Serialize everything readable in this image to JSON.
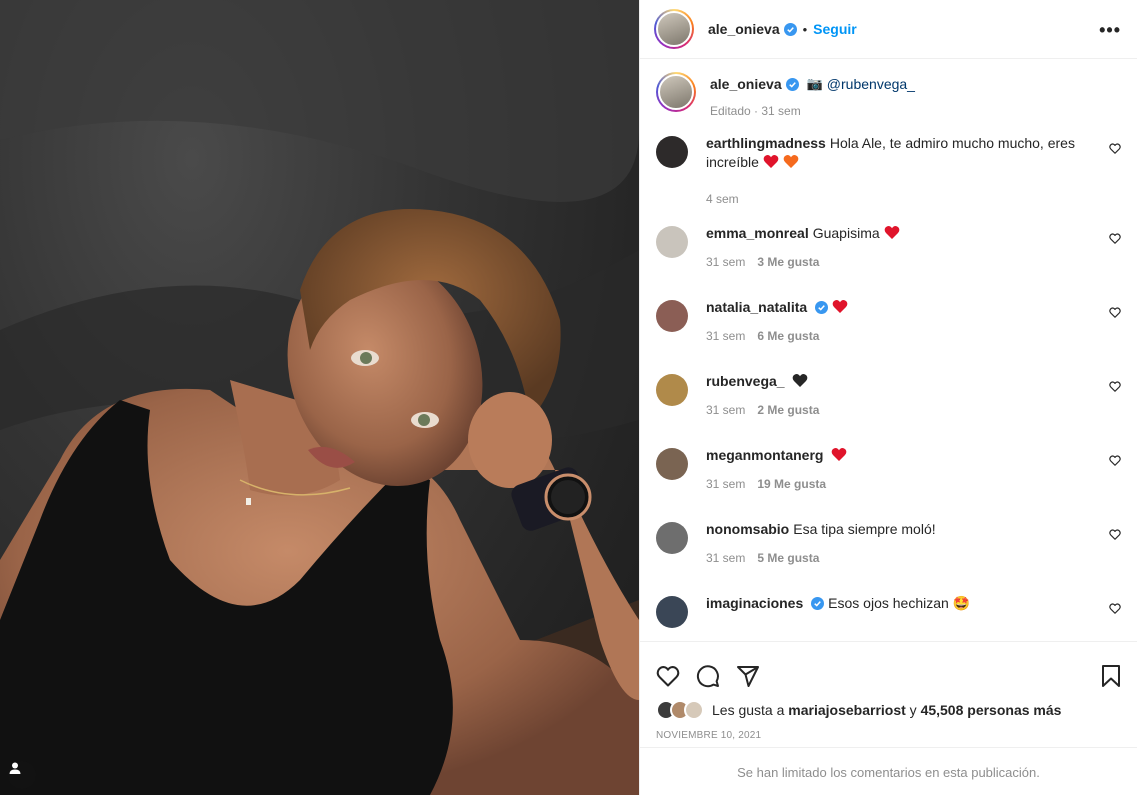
{
  "header": {
    "username": "ale_onieva",
    "separator": "•",
    "follow_label": "Seguir",
    "more_label": "•••"
  },
  "caption": {
    "username": "ale_onieva",
    "camera_emoji": "📷",
    "mention": "@rubenvega_",
    "meta": "Editado · 31 sem"
  },
  "comments": [
    {
      "username": "earthlingmadness",
      "text": "Hola Ale, te admiro mucho mucho, eres increíble",
      "hearts": [
        "#e0142b",
        "#f56a1e"
      ],
      "time": "4 sem",
      "likes": "",
      "avatar_color": "#2d2a2a",
      "verified": false
    },
    {
      "username": "emma_monreal",
      "text": "Guapisima",
      "hearts": [
        "#e0142b"
      ],
      "time": "31 sem",
      "likes": "3 Me gusta",
      "avatar_color": "#c9c4bc",
      "verified": false
    },
    {
      "username": "natalia_natalita",
      "text": "",
      "hearts": [
        "#e0142b"
      ],
      "time": "31 sem",
      "likes": "6 Me gusta",
      "avatar_color": "#8b5e55",
      "verified": true
    },
    {
      "username": "rubenvega_",
      "text": "",
      "hearts": [
        "#262626"
      ],
      "time": "31 sem",
      "likes": "2 Me gusta",
      "avatar_color": "#b08a4a",
      "verified": false
    },
    {
      "username": "meganmontanerg",
      "text": "",
      "hearts": [
        "#e0142b"
      ],
      "time": "31 sem",
      "likes": "19 Me gusta",
      "avatar_color": "#7a6452",
      "verified": false
    },
    {
      "username": "nonomsabio",
      "text": "Esa tipa siempre moló!",
      "hearts": [],
      "time": "31 sem",
      "likes": "5 Me gusta",
      "avatar_color": "#6e6e6e",
      "verified": false
    },
    {
      "username": "imaginaciones",
      "text": "Esos ojos hechizan",
      "emoji": "🤩",
      "hearts": [],
      "time": "",
      "likes": "",
      "avatar_color": "#3a4656",
      "verified": true
    }
  ],
  "likes": {
    "prefix": "Les gusta a",
    "first_user": "mariajosebarriost",
    "connector": "y",
    "others": "45,508 personas más"
  },
  "date": "NOVIEMBRE 10, 2021",
  "comments_limited": "Se han limitado los comentarios en esta publicación.",
  "colors": {
    "accent": "#0095f6",
    "verified": "#3897f0",
    "muted": "#8e8e8e"
  }
}
